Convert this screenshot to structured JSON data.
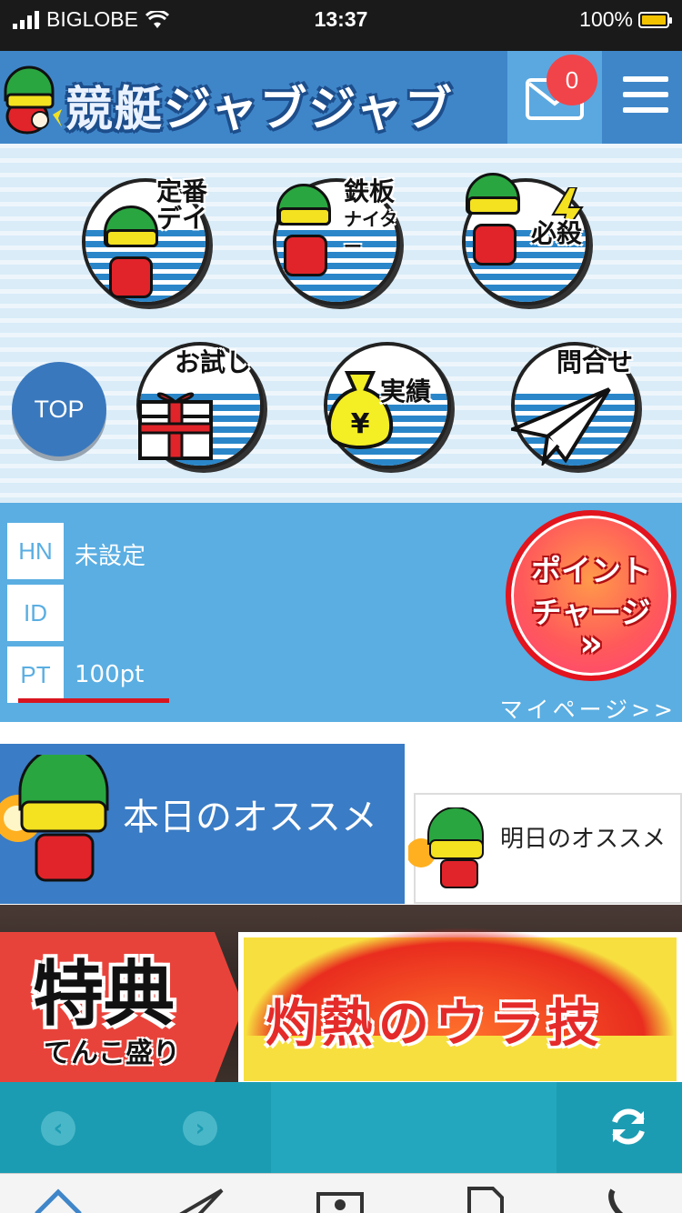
{
  "status_bar": {
    "carrier": "BIGLOBE",
    "time": "13:37",
    "battery_percent": "100%",
    "battery_level": 1.0
  },
  "header": {
    "logo_text_kanji": "競艇",
    "logo_text_kana": "ジャブジャブ",
    "mail_badge_count": "0",
    "icons": {
      "mail": "mail-icon",
      "menu": "hamburger-menu-icon"
    }
  },
  "nav": {
    "items": [
      {
        "line1": "定番",
        "line2": "デイ"
      },
      {
        "line1": "鉄板",
        "line2": "ナイター"
      },
      {
        "line1": "必殺",
        "line2": ""
      },
      {
        "line1": "お試し",
        "line2": ""
      },
      {
        "line1": "実績",
        "line2": ""
      },
      {
        "line1": "問合せ",
        "line2": ""
      }
    ],
    "top_button": "TOP",
    "colors": {
      "wave": "#2a86c9",
      "helmet": "#2aa640",
      "suit": "#e1242a"
    }
  },
  "member": {
    "hn_label": "HN",
    "hn_value": "未設定",
    "id_label": "ID",
    "id_value": "",
    "pt_label": "PT",
    "pt_value": "100pt",
    "charge_line1": "ポイント",
    "charge_line2": "チャージ",
    "charge_arrow": "»",
    "mypage_link": "マイページ>>"
  },
  "recommend": {
    "today": "本日のオススメ",
    "tomorrow": "明日のオススメ"
  },
  "banner": {
    "left_big": "特典",
    "left_small": "てんこ盛り",
    "right": "灼熱のウラ技"
  },
  "browser_bar": {
    "back_glyph": "‹",
    "forward_glyph": "›",
    "icons": {
      "back": "back-arrow-icon",
      "forward": "forward-arrow-icon",
      "refresh": "refresh-icon"
    }
  },
  "tab_bar": {
    "icons": [
      "home-icon",
      "send-icon",
      "money-icon",
      "document-icon",
      "phone-icon"
    ]
  }
}
